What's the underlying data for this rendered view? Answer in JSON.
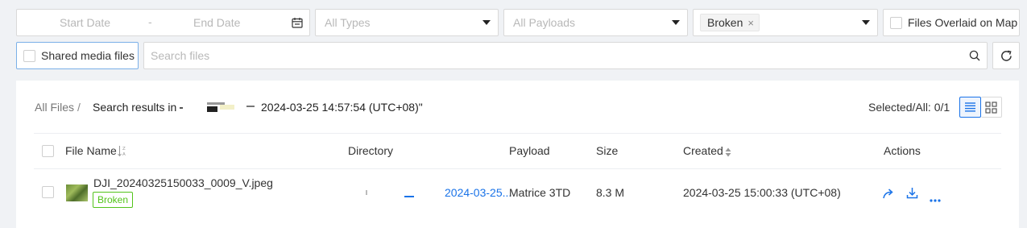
{
  "filters": {
    "start_date_placeholder": "Start Date",
    "date_separator": "-",
    "end_date_placeholder": "End Date",
    "types_placeholder": "All Types",
    "payloads_placeholder": "All Payloads",
    "status_tag": "Broken",
    "tag_remove": "×",
    "overlaid_label": "Files Overlaid on Map",
    "shared_label": "Shared media files",
    "search_placeholder": "Search files"
  },
  "breadcrumb": {
    "root": "All Files",
    "separator": "/",
    "search_prefix": "Search results in",
    "search_suffix": "2024-03-25 14:57:54 (UTC+08)\""
  },
  "selection": {
    "label": "Selected/All: 0/1"
  },
  "table": {
    "columns": {
      "name": "File Name",
      "directory": "Directory",
      "payload": "Payload",
      "size": "Size",
      "created": "Created",
      "actions": "Actions"
    },
    "rows": [
      {
        "file_name": "DJI_20240325150033_0009_V.jpeg",
        "status": "Broken",
        "directory": "2024-03-25...",
        "payload": "Matrice 3TD",
        "size": "8.3 M",
        "created": "2024-03-25 15:00:33 (UTC+08)"
      }
    ]
  },
  "colors": {
    "accent": "#1a73e8",
    "broken": "#52c41a"
  },
  "icons": [
    "calendar-icon",
    "search-icon",
    "refresh-icon",
    "list-view-icon",
    "grid-view-icon",
    "sort-az-icon",
    "sort-icon",
    "share-icon",
    "download-icon",
    "more-icon"
  ]
}
